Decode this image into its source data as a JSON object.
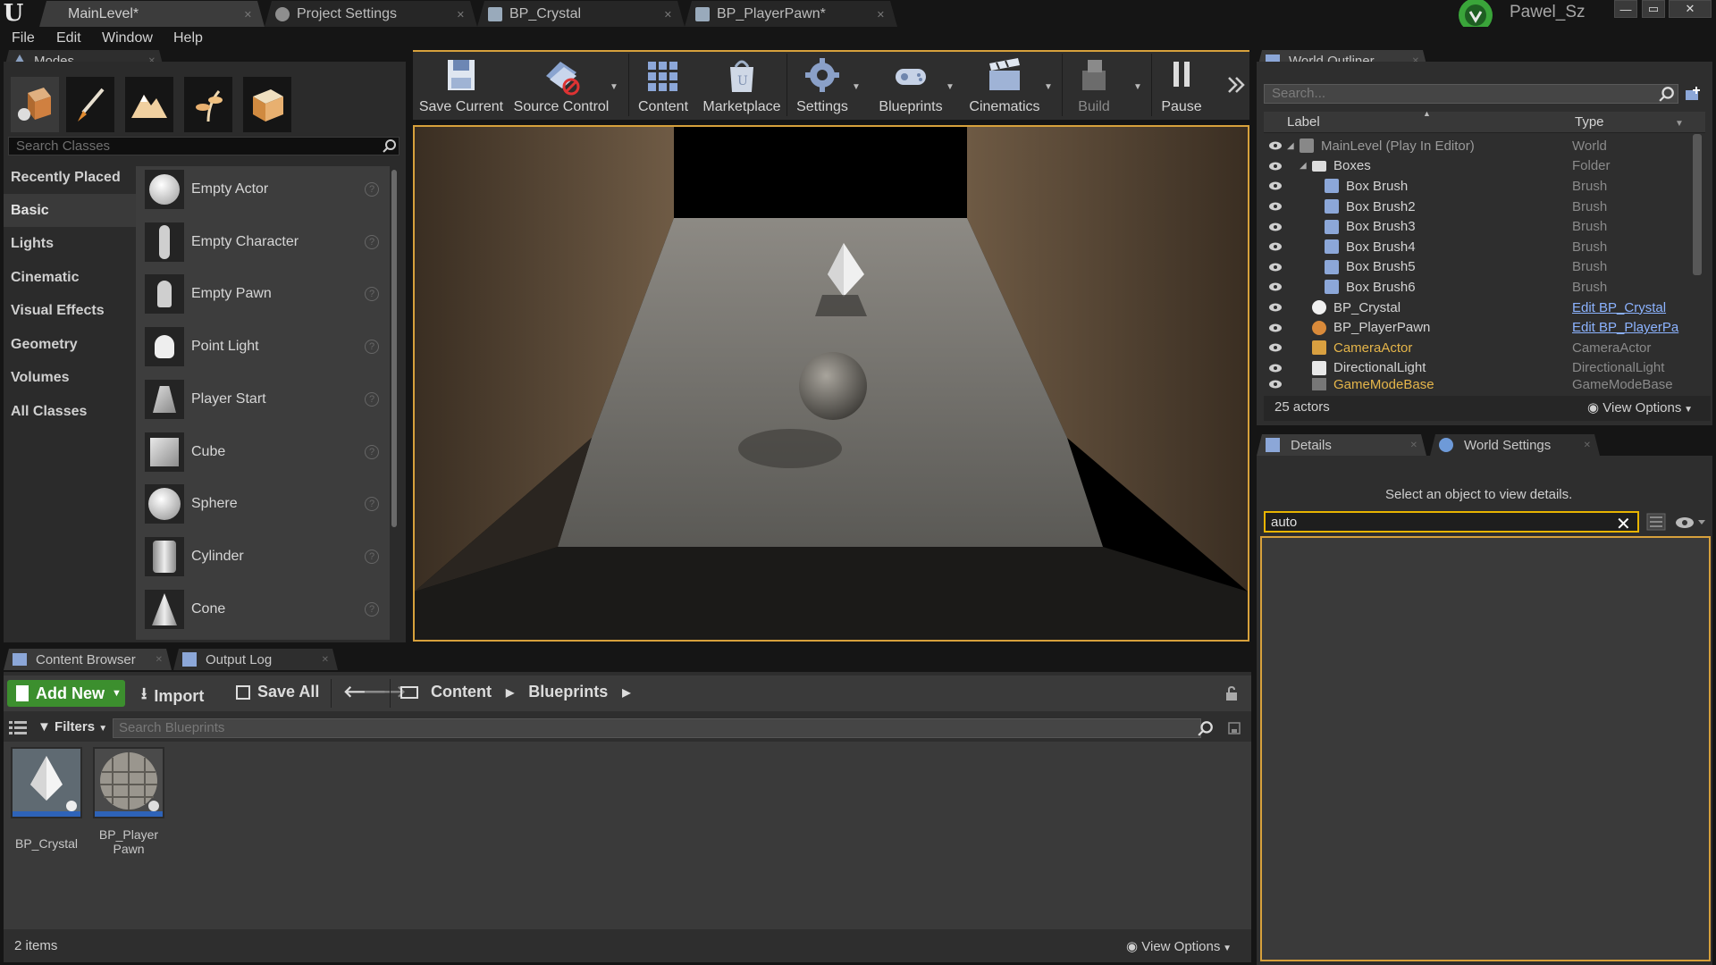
{
  "window": {
    "doc_tabs": [
      "MainLevel*",
      "Project Settings",
      "BP_Crystal",
      "BP_PlayerPawn*"
    ],
    "user_name": "Pawel_Sz",
    "controls": {
      "minimize": "—",
      "maximize": "▭",
      "close": "✕"
    }
  },
  "menu": {
    "items": [
      "File",
      "Edit",
      "Window",
      "Help"
    ]
  },
  "modes": {
    "tab_label": "Modes",
    "tools": [
      "place-mode-icon",
      "paint-mode-icon",
      "landscape-mode-icon",
      "foliage-mode-icon",
      "geometry-mode-icon"
    ],
    "search_placeholder": "Search Classes",
    "categories": [
      "Recently Placed",
      "Basic",
      "Lights",
      "Cinematic",
      "Visual Effects",
      "Geometry",
      "Volumes",
      "All Classes"
    ],
    "active_category": "Basic",
    "classes": [
      "Empty Actor",
      "Empty Character",
      "Empty Pawn",
      "Point Light",
      "Player Start",
      "Cube",
      "Sphere",
      "Cylinder",
      "Cone"
    ]
  },
  "toolbar": {
    "buttons": [
      "Save Current",
      "Source Control",
      "Content",
      "Marketplace",
      "Settings",
      "Blueprints",
      "Cinematics",
      "Build",
      "Pause"
    ]
  },
  "content_browser": {
    "tabs": [
      "Content Browser",
      "Output Log"
    ],
    "add_new": "Add New",
    "import": "Import",
    "save_all": "Save All",
    "breadcrumb": [
      "Content",
      "Blueprints"
    ],
    "filters": "Filters",
    "search_placeholder": "Search Blueprints",
    "assets": [
      {
        "label": "BP_Crystal"
      },
      {
        "label_line1": "BP_Player",
        "label_line2": "Pawn"
      }
    ],
    "item_count": "2 items",
    "view_options": "View Options"
  },
  "world_outliner": {
    "tab_label": "World Outliner",
    "search_placeholder": "Search...",
    "col_label": "Label",
    "col_type": "Type",
    "rows": [
      {
        "label": "MainLevel (Play In Editor)",
        "type": "World"
      },
      {
        "label": "Boxes",
        "type": "Folder"
      },
      {
        "label": "Box Brush",
        "type": "Brush"
      },
      {
        "label": "Box Brush2",
        "type": "Brush"
      },
      {
        "label": "Box Brush3",
        "type": "Brush"
      },
      {
        "label": "Box Brush4",
        "type": "Brush"
      },
      {
        "label": "Box Brush5",
        "type": "Brush"
      },
      {
        "label": "Box Brush6",
        "type": "Brush"
      },
      {
        "label": "BP_Crystal",
        "type": "Edit BP_Crystal"
      },
      {
        "label": "BP_PlayerPawn",
        "type": "Edit BP_PlayerPa"
      },
      {
        "label": "CameraActor",
        "type": "CameraActor"
      },
      {
        "label": "DirectionalLight",
        "type": "DirectionalLight"
      },
      {
        "label": "GameModeBase",
        "type": "GameModeBase"
      }
    ],
    "actor_count": "25 actors",
    "view_options": "View Options"
  },
  "details": {
    "tabs": [
      "Details",
      "World Settings"
    ],
    "hint": "Select an object to view details.",
    "search_value": "auto"
  },
  "colors": {
    "accent": "#d7a13c",
    "add_new": "#3c8f2e",
    "link": "#8cb3ff",
    "highlight_text": "#e5b54a"
  }
}
